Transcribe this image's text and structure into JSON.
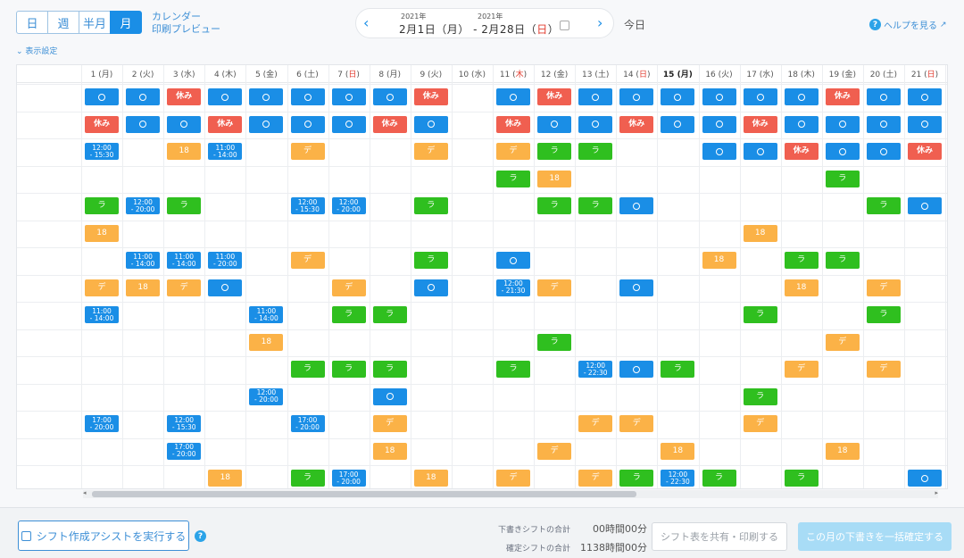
{
  "header": {
    "view_tabs": [
      "日",
      "週",
      "半月",
      "月"
    ],
    "active_view": "月",
    "calendar_link": "カレンダー",
    "print_preview_link": "印刷プレビュー",
    "start_year": "2021年",
    "end_year": "2021年",
    "range_start": "2月1日（月）",
    "range_sep": "-",
    "range_end_prefix": "2月28日（",
    "range_end_day": "日",
    "range_end_suffix": "）",
    "today": "今日",
    "help": "ヘルプを見る",
    "display_settings": "表示設定"
  },
  "days": [
    {
      "d": "1",
      "w": "月",
      "holiday": false
    },
    {
      "d": "2",
      "w": "火",
      "holiday": false
    },
    {
      "d": "3",
      "w": "水",
      "holiday": false
    },
    {
      "d": "4",
      "w": "木",
      "holiday": false
    },
    {
      "d": "5",
      "w": "金",
      "holiday": false
    },
    {
      "d": "6",
      "w": "土",
      "holiday": false
    },
    {
      "d": "7",
      "w": "日",
      "holiday": true
    },
    {
      "d": "8",
      "w": "月",
      "holiday": false
    },
    {
      "d": "9",
      "w": "火",
      "holiday": false
    },
    {
      "d": "10",
      "w": "水",
      "holiday": false
    },
    {
      "d": "11",
      "w": "木",
      "holiday": true
    },
    {
      "d": "12",
      "w": "金",
      "holiday": false
    },
    {
      "d": "13",
      "w": "土",
      "holiday": false
    },
    {
      "d": "14",
      "w": "日",
      "holiday": true
    },
    {
      "d": "15",
      "w": "月",
      "holiday": false,
      "today": true
    },
    {
      "d": "16",
      "w": "火",
      "holiday": false
    },
    {
      "d": "17",
      "w": "水",
      "holiday": false
    },
    {
      "d": "18",
      "w": "木",
      "holiday": false
    },
    {
      "d": "19",
      "w": "金",
      "holiday": false
    },
    {
      "d": "20",
      "w": "土",
      "holiday": false
    },
    {
      "d": "21",
      "w": "日",
      "holiday": true
    }
  ],
  "legend_codes": {
    "o": "○ (blue)",
    "x": "休み",
    "r": "ラ",
    "d": "デ",
    "e": "18"
  },
  "rows": [
    [
      "o",
      "o",
      "x",
      "o",
      "o",
      "o",
      "o",
      "o",
      "x",
      "",
      "o",
      "x",
      "o",
      "o",
      "o",
      "o",
      "o",
      "o",
      "x",
      "o",
      "o"
    ],
    [
      "x",
      "o",
      "o",
      "x",
      "o",
      "o",
      "o",
      "x",
      "o",
      "",
      "x",
      "o",
      "o",
      "x",
      "o",
      "o",
      "x",
      "o",
      "o",
      "o",
      "o"
    ],
    [
      "12:00 - 15:30",
      "",
      "e",
      "11:00 - 14:00",
      "",
      "d",
      "",
      "",
      "d",
      "",
      "d",
      "r",
      "r",
      "",
      "",
      "o",
      "o",
      "x",
      "o",
      "o",
      "x"
    ],
    [
      "",
      "",
      "",
      "",
      "",
      "",
      "",
      "",
      "",
      "",
      "r",
      "e",
      "",
      "",
      "",
      "",
      "",
      "",
      "r",
      "",
      ""
    ],
    [
      "r",
      "12:00 - 20:00",
      "r",
      "",
      "",
      "12:00 - 15:30",
      "12:00 - 20:00",
      "",
      "r",
      "",
      "",
      "r",
      "r",
      "o",
      "",
      "",
      "",
      "",
      "",
      "r",
      "o"
    ],
    [
      "e",
      "",
      "",
      "",
      "",
      "",
      "",
      "",
      "",
      "",
      "",
      "",
      "",
      "",
      "",
      "",
      "e",
      "",
      "",
      "",
      ""
    ],
    [
      "",
      "11:00 - 14:00",
      "11:00 - 14:00",
      "11:00 - 20:00",
      "",
      "d",
      "",
      "",
      "r",
      "",
      "o",
      "",
      "",
      "",
      "",
      "e",
      "",
      "r",
      "r",
      "",
      ""
    ],
    [
      "d",
      "e",
      "d",
      "o",
      "",
      "",
      "d",
      "",
      "o",
      "",
      "12:00 - 21:30",
      "d",
      "",
      "o",
      "",
      "",
      "",
      "e",
      "",
      "d",
      ""
    ],
    [
      "11:00 - 14:00",
      "",
      "",
      "",
      "11:00 - 14:00",
      "",
      "r",
      "r",
      "",
      "",
      "",
      "",
      "",
      "",
      "",
      "",
      "r",
      "",
      "",
      "r",
      ""
    ],
    [
      "",
      "",
      "",
      "",
      "e",
      "",
      "",
      "",
      "",
      "",
      "",
      "r",
      "",
      "",
      "",
      "",
      "",
      "",
      "d",
      "",
      ""
    ],
    [
      "",
      "",
      "",
      "",
      "",
      "r",
      "r",
      "r",
      "",
      "",
      "r",
      "",
      "12:00 - 22:30",
      "o",
      "r",
      "",
      "",
      "d",
      "",
      "d",
      ""
    ],
    [
      "",
      "",
      "",
      "",
      "12:00 - 20:00",
      "",
      "",
      "o",
      "",
      "",
      "",
      "",
      "",
      "",
      "",
      "",
      "r",
      "",
      "",
      "",
      ""
    ],
    [
      "17:00 - 20:00",
      "",
      "12:00 - 15:30",
      "",
      "",
      "17:00 - 20:00",
      "",
      "d",
      "",
      "",
      "",
      "",
      "d",
      "d",
      "",
      "",
      "d",
      "",
      "",
      "",
      ""
    ],
    [
      "",
      "",
      "17:00 - 20:00",
      "",
      "",
      "",
      "",
      "e",
      "",
      "",
      "",
      "d",
      "",
      "",
      "e",
      "",
      "",
      "",
      "e",
      "",
      ""
    ],
    [
      "",
      "",
      "",
      "e",
      "",
      "r",
      "17:00 - 20:00",
      "",
      "e",
      "",
      "d",
      "",
      "d",
      "r",
      "12:00 - 22:30",
      "r",
      "",
      "r",
      "",
      "",
      "o"
    ]
  ],
  "footer": {
    "assist_button": "シフト作成アシストを実行する",
    "draft_total_label": "下書きシフトの合計",
    "draft_total_value": "00時間00分",
    "confirmed_total_label": "確定シフトの合計",
    "confirmed_total_value": "1138時間00分",
    "share_button": "シフト表を共有・印刷する",
    "confirm_button": "この月の下書きを一括確定する"
  },
  "colors": {
    "blue": "#1a8ee6",
    "red": "#f05f50",
    "green": "#2fbf1f",
    "orange": "#fbb247",
    "holiday_text": "#e23b2e"
  }
}
